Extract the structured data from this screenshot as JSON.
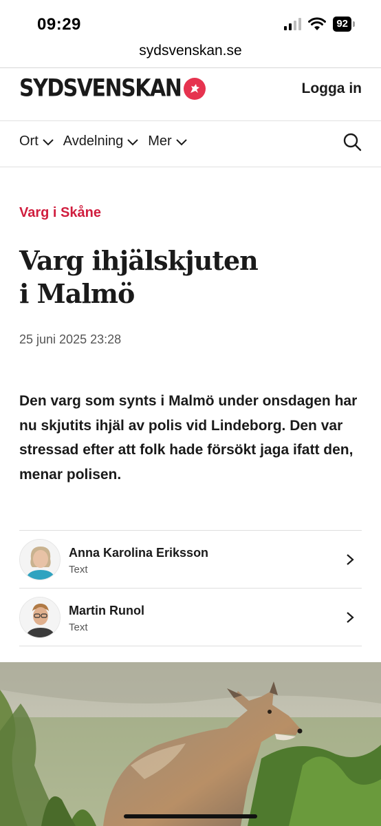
{
  "status_bar": {
    "time": "09:29",
    "battery": "92",
    "icons": [
      "cellular-signal-icon",
      "wifi-icon",
      "battery-icon"
    ]
  },
  "browser": {
    "url": "sydsvenskan.se"
  },
  "header": {
    "logo_text": "SYDSVENSKAN",
    "login_label": "Logga in",
    "brand_color": "#e6334f"
  },
  "nav": {
    "items": [
      {
        "label": "Ort"
      },
      {
        "label": "Avdelning"
      },
      {
        "label": "Mer"
      }
    ],
    "search_icon": "search-icon"
  },
  "article": {
    "kicker": "Varg i Skåne",
    "kicker_color": "#d01d3e",
    "headline_line1": "Varg ihjälskjuten",
    "headline_line2": "i Malmö",
    "date": "25 juni 2025 23:28",
    "lead": "Den varg som synts i Malmö under onsdagen har nu skjutits ihjäl av polis vid Lindeborg. Den var stressad efter att folk hade försökt jaga ifatt den, menar polisen.",
    "authors": [
      {
        "name": "Anna Karolina Eriksson",
        "role": "Text"
      },
      {
        "name": "Martin Runol",
        "role": "Text"
      }
    ]
  }
}
